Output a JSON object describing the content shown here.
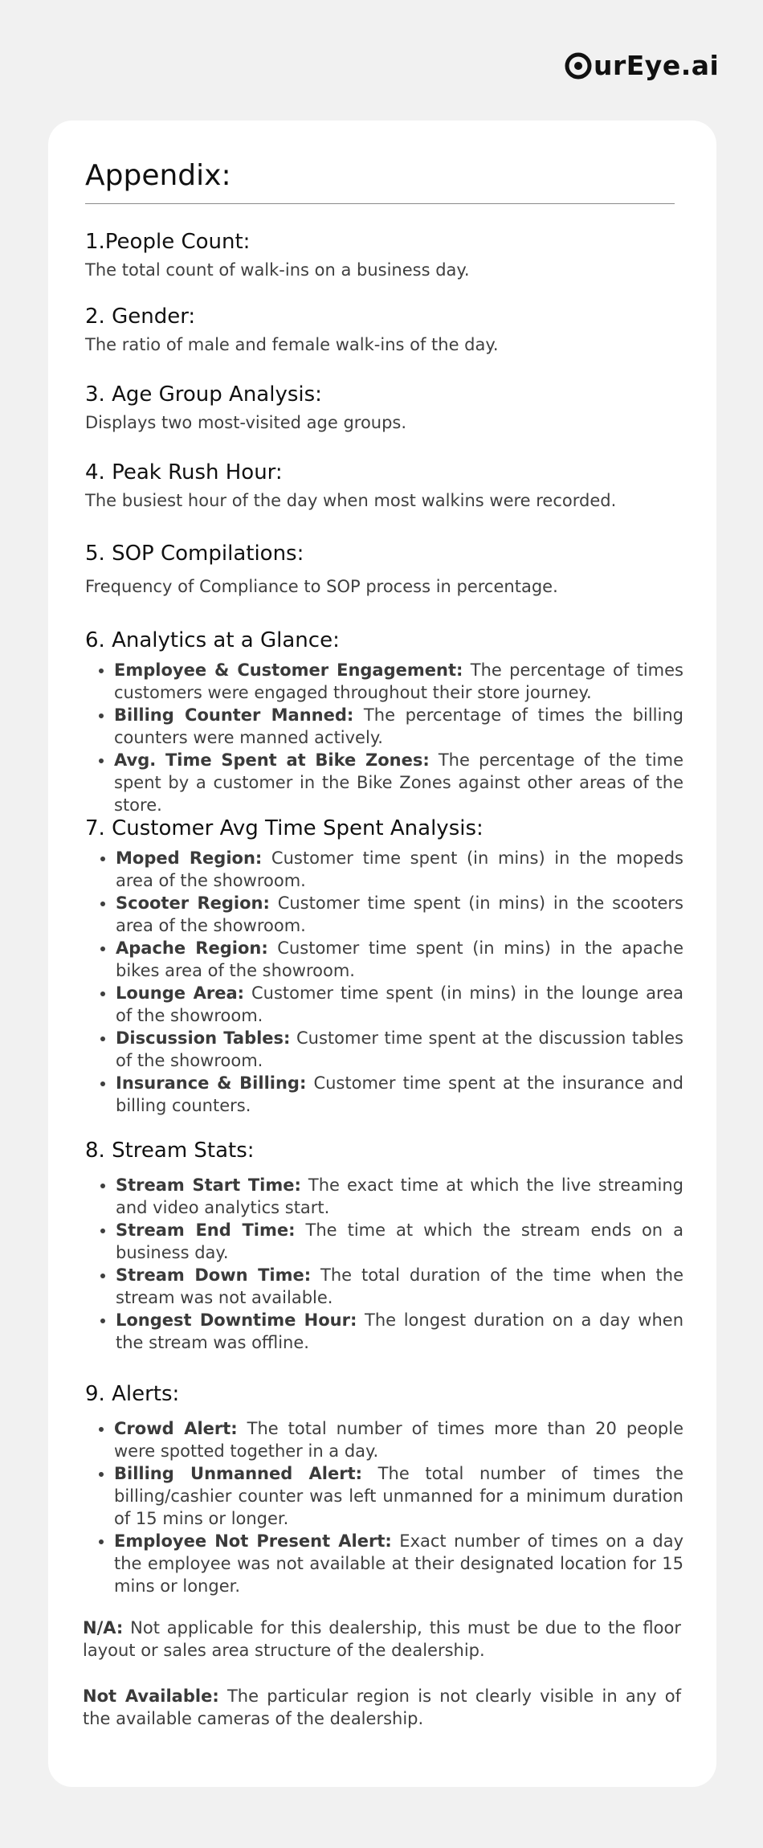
{
  "brand": {
    "logo_text": "urEye.ai"
  },
  "appendix": {
    "title": "Appendix:"
  },
  "sections": [
    {
      "heading": "1.People Count:",
      "description": "The total count of walk-ins on a business day."
    },
    {
      "heading": "2. Gender:",
      "description": "The ratio of male and female walk-ins of the day."
    },
    {
      "heading": "3. Age Group Analysis:",
      "description": "Displays two most-visited age groups."
    },
    {
      "heading": "4. Peak Rush Hour:",
      "description": "The busiest hour of the day when most walkins were recorded."
    },
    {
      "heading": "5. SOP Compilations:",
      "description": "Frequency of Compliance to SOP process in percentage."
    },
    {
      "heading": "6. Analytics at a Glance:",
      "items": [
        {
          "term": "Employee & Customer Engagement:",
          "text": " The percentage of times customers were engaged throughout their store journey."
        },
        {
          "term": "Billing Counter Manned:",
          "text": " The percentage of times the billing counters were manned actively."
        },
        {
          "term": "Avg. Time Spent at Bike Zones:",
          "text": " The percentage of the time spent by a customer in the Bike Zones against other areas of the store."
        }
      ]
    },
    {
      "heading": "7. Customer Avg Time Spent Analysis:",
      "items": [
        {
          "term": "Moped Region:",
          "text": " Customer time spent (in mins) in the mopeds area of the showroom."
        },
        {
          "term": "Scooter Region:",
          "text": " Customer time spent (in mins) in the scooters area of the showroom."
        },
        {
          "term": "Apache Region:",
          "text": " Customer time spent (in mins) in the apache bikes area of the showroom."
        },
        {
          "term": "Lounge Area:",
          "text": " Customer time spent (in mins) in the lounge area of the showroom."
        },
        {
          "term": "Discussion Tables:",
          "text": " Customer time spent at the discussion tables of the showroom."
        },
        {
          "term": "Insurance & Billing:",
          "text": " Customer time spent at the insurance and billing counters."
        }
      ]
    },
    {
      "heading": "8. Stream Stats:",
      "items": [
        {
          "term": "Stream Start Time:",
          "text": " The exact time at which the live streaming and video analytics start."
        },
        {
          "term": "Stream End Time:",
          "text": " The time at which the stream ends on a business day."
        },
        {
          "term": "Stream Down Time:",
          "text": " The total duration of the time when the stream was not available."
        },
        {
          "term": "Longest Downtime Hour:",
          "text": " The longest duration on a day when the stream was offline."
        }
      ]
    },
    {
      "heading": "9. Alerts:",
      "items": [
        {
          "term": "Crowd Alert:",
          "text": " The total number of times more than 20 people were spotted together in a day."
        },
        {
          "term": "Billing Unmanned Alert:",
          "text": " The total number of times the billing/cashier counter was left unmanned for a minimum duration of 15 mins or longer."
        },
        {
          "term": "Employee Not Present Alert:",
          "text": " Exact number of times on a day the employee was not available at their designated location for 15 mins or longer."
        }
      ]
    }
  ],
  "notes": [
    {
      "term": "N/A:",
      "text": " Not applicable for this dealership, this must be due to the floor layout or sales area structure of the dealership."
    },
    {
      "term": "Not Available:",
      "text": " The particular region is not clearly visible in any of the available cameras of the dealership."
    }
  ]
}
